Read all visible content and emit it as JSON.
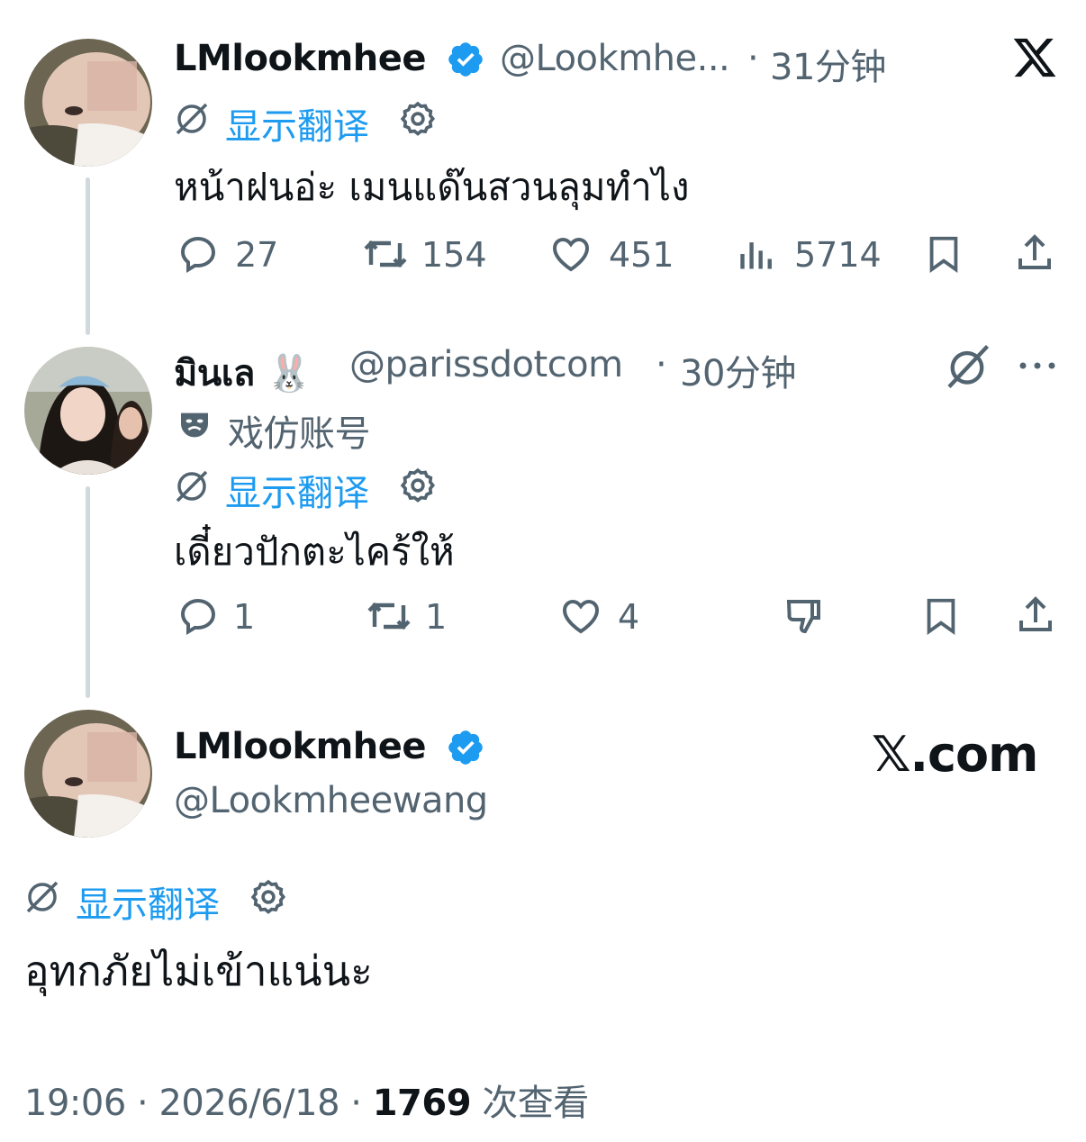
{
  "tweet1": {
    "display_name": "LMlookmhee",
    "handle": "@Lookmhe...",
    "dot": "·",
    "time": "31分钟",
    "translate_label": "显示翻译",
    "text": "หน้าฝนอ่ะ เมนแด๊นสวนลุมทำไง",
    "stats": {
      "replies": "27",
      "reposts": "154",
      "likes": "451",
      "views": "5714"
    }
  },
  "tweet2": {
    "display_name": "มินเล 🐰",
    "handle": "@parissdotcom",
    "dot": "·",
    "time": "30分钟",
    "parody_label": "戏仿账号",
    "translate_label": "显示翻译",
    "text": "เดี๋ยวปักตะไคร้ให้",
    "stats": {
      "replies": "1",
      "reposts": "1",
      "likes": "4"
    }
  },
  "main": {
    "display_name": "LMlookmhee",
    "handle": "@Lookmheewang",
    "brand": "𝕏.com",
    "translate_label": "显示翻译",
    "text": "อุทกภัยไม่เข้าแน่นะ",
    "time": "19:06",
    "date": "2026/6/18",
    "sep": "·",
    "views": "1769",
    "views_label": "次查看"
  },
  "colors": {
    "accent": "#1d9bf0",
    "muted": "#536471",
    "line": "#cfd9de",
    "verified": "#1d9bf0"
  },
  "icons": [
    "x-logo-icon",
    "verified-badge-icon",
    "translate-icon",
    "gear-icon",
    "reply-icon",
    "repost-icon",
    "like-icon",
    "views-icon",
    "bookmark-icon",
    "share-icon",
    "grok-icon",
    "more-icon",
    "parody-mask-icon",
    "dislike-icon"
  ]
}
